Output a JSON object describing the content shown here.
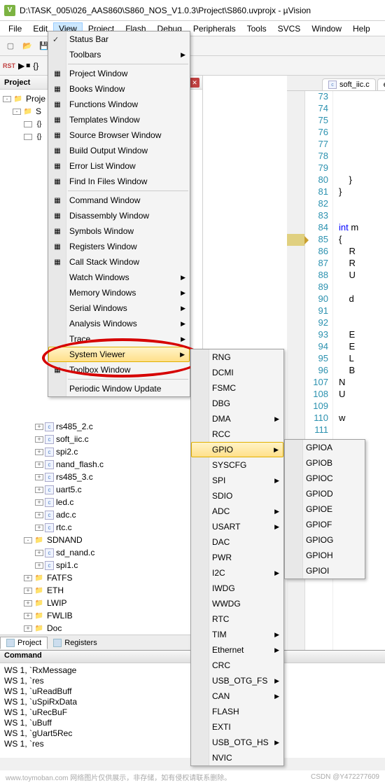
{
  "title": "D:\\TASK_005\\026_AAS860\\S860_NOS_V1.0.3\\Project\\S860.uvprojx - µVision",
  "menubar": [
    "File",
    "Edit",
    "View",
    "Project",
    "Flash",
    "Debug",
    "Peripherals",
    "Tools",
    "SVCS",
    "Window",
    "Help"
  ],
  "project_panel": {
    "title": "Project"
  },
  "tree": {
    "root": "Proje",
    "target": "S",
    "groups_top": [],
    "files_visible": [
      "rs485_2.c",
      "soft_iic.c",
      "spi2.c",
      "nand_flash.c",
      "rs485_3.c",
      "uart5.c",
      "led.c",
      "adc.c",
      "rtc.c"
    ],
    "folders": [
      "SDNAND"
    ],
    "sd_files": [
      "sd_nand.c",
      "spi1.c"
    ],
    "tail_folders": [
      "FATFS",
      "ETH",
      "LWIP",
      "FWLIB",
      "Doc"
    ]
  },
  "editor": {
    "tabs": [
      {
        "label": "soft_iic.c"
      },
      {
        "label": "ee"
      }
    ],
    "lines": [
      73,
      74,
      75,
      76,
      77,
      78,
      79,
      80,
      81,
      82,
      83,
      84,
      85,
      86,
      87,
      88,
      89,
      90,
      91,
      92,
      93,
      94,
      95,
      96,
      107,
      108,
      109,
      110,
      111
    ],
    "current_line": 85,
    "code": {
      "80": "    }",
      "81": "}",
      "84_kw": "int",
      "84_rest": " m",
      "85": "{",
      "86": "    R",
      "87": "    R",
      "88": "    U",
      "90": "    d",
      "93": "    E",
      "94": "    E",
      "95": "    L",
      "96": "    B",
      "107": "N",
      "108": "U",
      "110": "w"
    }
  },
  "view_menu": [
    {
      "label": "Status Bar",
      "check": true
    },
    {
      "label": "Toolbars",
      "sub": true
    },
    {
      "sep": true
    },
    {
      "label": "Project Window",
      "ic": "pw"
    },
    {
      "label": "Books Window",
      "ic": "bw"
    },
    {
      "label": "Functions Window",
      "ic": "fw"
    },
    {
      "label": "Templates Window",
      "ic": "tw"
    },
    {
      "label": "Source Browser Window",
      "ic": "sb"
    },
    {
      "label": "Build Output Window",
      "ic": "bo"
    },
    {
      "label": "Error List Window",
      "ic": "el"
    },
    {
      "label": "Find In Files Window",
      "ic": "ff"
    },
    {
      "sep": true
    },
    {
      "label": "Command Window",
      "ic": "cw"
    },
    {
      "label": "Disassembly Window",
      "ic": "dw"
    },
    {
      "label": "Symbols Window",
      "ic": "sw"
    },
    {
      "label": "Registers Window",
      "ic": "rw"
    },
    {
      "label": "Call Stack Window",
      "ic": "cs"
    },
    {
      "label": "Watch Windows",
      "sub": true
    },
    {
      "label": "Memory Windows",
      "sub": true
    },
    {
      "label": "Serial Windows",
      "sub": true
    },
    {
      "label": "Analysis Windows",
      "sub": true
    },
    {
      "label": "Trace",
      "sub": true
    },
    {
      "label": "System Viewer",
      "sub": true,
      "hover": true
    },
    {
      "label": "Toolbox Window",
      "ic": "tb"
    },
    {
      "sep": true
    },
    {
      "label": "Periodic Window Update"
    }
  ],
  "system_viewer": [
    "RNG",
    "DCMI",
    "FSMC",
    "DBG",
    "DMA",
    "RCC",
    "GPIO",
    "SYSCFG",
    "SPI",
    "SDIO",
    "ADC",
    "USART",
    "DAC",
    "PWR",
    "I2C",
    "IWDG",
    "WWDG",
    "RTC",
    "TIM",
    "Ethernet",
    "CRC",
    "USB_OTG_FS",
    "CAN",
    "FLASH",
    "EXTI",
    "USB_OTG_HS",
    "NVIC"
  ],
  "system_viewer_sub": {
    "DMA": true,
    "GPIO": true,
    "SPI": true,
    "ADC": true,
    "USART": true,
    "I2C": true,
    "TIM": true,
    "Ethernet": true,
    "USB_OTG_FS": true,
    "CAN": true,
    "USB_OTG_HS": true
  },
  "system_viewer_hover": "GPIO",
  "gpio_items": [
    "GPIOA",
    "GPIOB",
    "GPIOC",
    "GPIOD",
    "GPIOE",
    "GPIOF",
    "GPIOG",
    "GPIOH",
    "GPIOI"
  ],
  "bottom_tabs": [
    "Project",
    "Registers"
  ],
  "command": {
    "title": "Command",
    "lines": [
      "WS 1, `RxMessage",
      "WS 1, `res",
      "WS 1, `uReadBuff",
      "WS 1, `uSpiRxData",
      "WS 1, `uRecBuF",
      "WS 1, `uBuff",
      "WS 1, `gUart5Rec",
      "WS 1, `res"
    ]
  },
  "footer": {
    "left": "www.toymoban.com 网络图片仅供展示，非存储，如有侵权请联系删除。",
    "right": "CSDN @Y472277609"
  }
}
